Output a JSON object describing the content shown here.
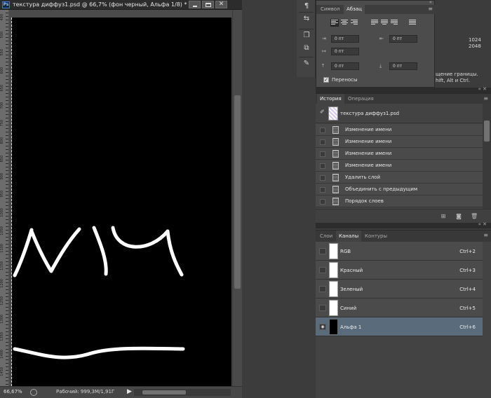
{
  "document": {
    "title": "текстура диффуз1.psd @ 66,7% (фон черный, Альфа 1/8) *",
    "app_logo": "Ps",
    "window_buttons": {
      "minimize": "minimize-icon",
      "maximize": "maximize-icon",
      "close": "✕"
    },
    "ruler_labels": [
      "400",
      "500",
      "550",
      "600",
      "650",
      "700",
      "750",
      "800",
      "850",
      "900",
      "950",
      "1000",
      "1050",
      "1100",
      "1150",
      "1200",
      "1250",
      "1300",
      "1350",
      "1400",
      "1450"
    ],
    "status": {
      "zoom": "66,67%",
      "doc_info": "Рабочий: 999,3M/1,91Г",
      "arrow": "▶"
    }
  },
  "toolstrip": {
    "icons": [
      "character-style-icon",
      "adjust-icon",
      "clone-source-icon",
      "paste-icon",
      "brush-preset-icon"
    ]
  },
  "paragraph_panel": {
    "tabs": [
      "Символ",
      "Абзац"
    ],
    "active_tab": "Абзац",
    "fields": {
      "indent_left": "0 пт",
      "indent_right": "0 пт",
      "indent_first": "0 пт",
      "space_before": "0 пт",
      "space_after": "0 пт"
    },
    "hyphenation_label": "Переносы",
    "hyphenation_checked": true
  },
  "info_panel": {
    "width": "1024",
    "height": "2048",
    "hint_line1": "щение границы.",
    "hint_line2": "hift, Alt и Ctrl."
  },
  "history_panel": {
    "tabs": [
      "История",
      "Операция"
    ],
    "active_tab": "История",
    "snapshot": "текстура диффуз1.psd",
    "items": [
      "Изменение имени",
      "Изменение имени",
      "Изменение имени",
      "Изменение имени",
      "Удалить слой",
      "Объединить с предыдущим",
      "Порядок слоев"
    ],
    "footer_icons": [
      "new-document-from-state-icon",
      "camera-icon",
      "trash-icon"
    ]
  },
  "channels_panel": {
    "tabs": [
      "Слои",
      "Каналы",
      "Контуры"
    ],
    "active_tab": "Каналы",
    "channels": [
      {
        "name": "RGB",
        "shortcut": "Ctrl+2",
        "visible": false,
        "selected": false
      },
      {
        "name": "Красный",
        "shortcut": "Ctrl+3",
        "visible": false,
        "selected": false
      },
      {
        "name": "Зеленый",
        "shortcut": "Ctrl+4",
        "visible": false,
        "selected": false
      },
      {
        "name": "Синий",
        "shortcut": "Ctrl+5",
        "visible": false,
        "selected": false
      },
      {
        "name": "Альфа 1",
        "shortcut": "Ctrl+6",
        "visible": true,
        "selected": true
      }
    ]
  },
  "colors": {
    "canvas": "#000000",
    "selected_row": "#5a6b7c",
    "panel_bg": "#434343"
  }
}
